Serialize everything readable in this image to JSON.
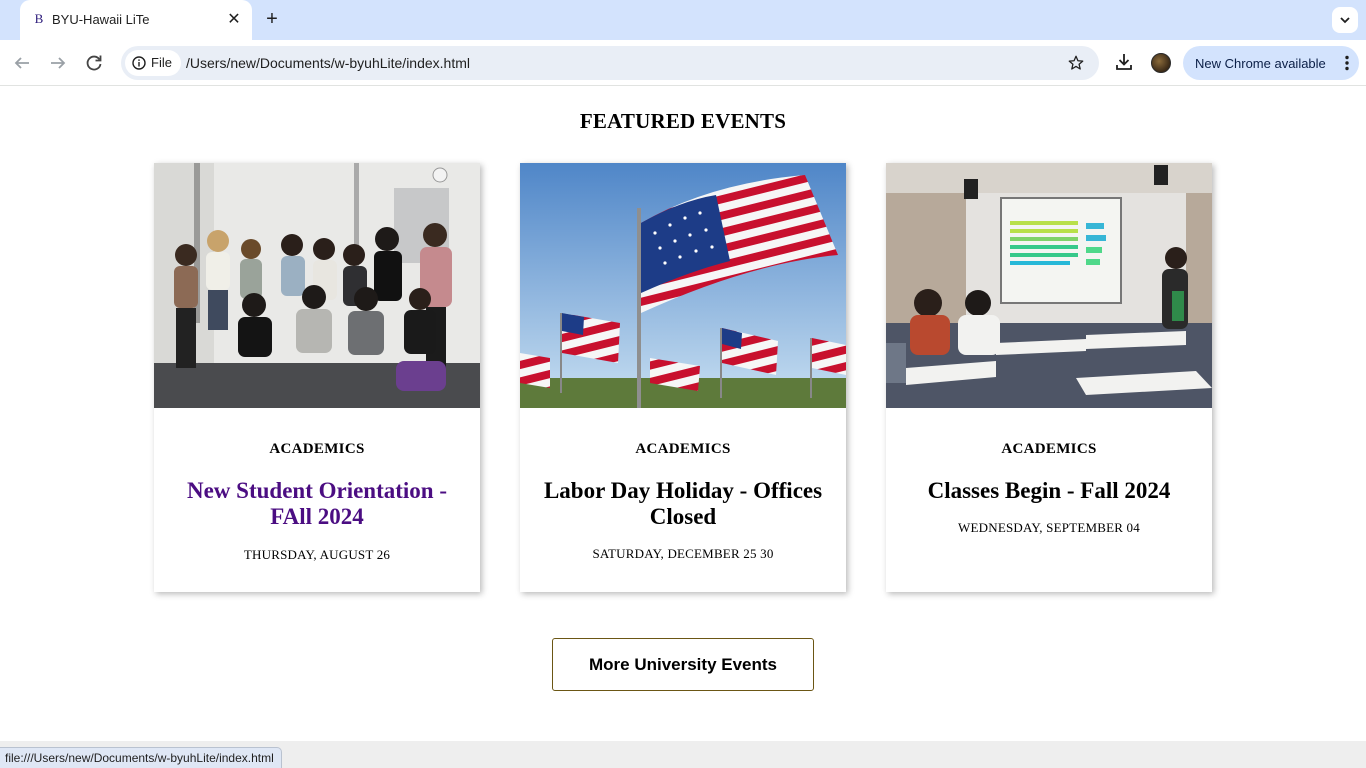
{
  "browser": {
    "tab_favicon": "B",
    "tab_title": "BYU-Hawaii LiTe",
    "new_tab": "+",
    "close": "✕",
    "file_chip": "File",
    "url": "/Users/new/Documents/w-byuhLite/index.html",
    "update_label": "New Chrome available",
    "status_url": "file:///Users/new/Documents/w-byuhLite/index.html"
  },
  "events": {
    "heading": "FEATURED EVENTS",
    "cards": [
      {
        "category": "ACADEMICS",
        "title": "New Student Orientation - FAll 2024",
        "date": "THURSDAY, AUGUST 26",
        "image": "group-photo"
      },
      {
        "category": "ACADEMICS",
        "title": "Labor Day Holiday - Offices Closed",
        "date": "SATURDAY, DECEMBER 25 30",
        "image": "american-flags"
      },
      {
        "category": "ACADEMICS",
        "title": "Classes Begin - Fall 2024",
        "date": "WEDNESDAY, SEPTEMBER 04",
        "image": "classroom"
      }
    ],
    "more_button": "More University Events"
  },
  "colors": {
    "visited_link": "#4b0d82",
    "button_border": "#6b5614",
    "tabbar": "#d3e3fd"
  }
}
